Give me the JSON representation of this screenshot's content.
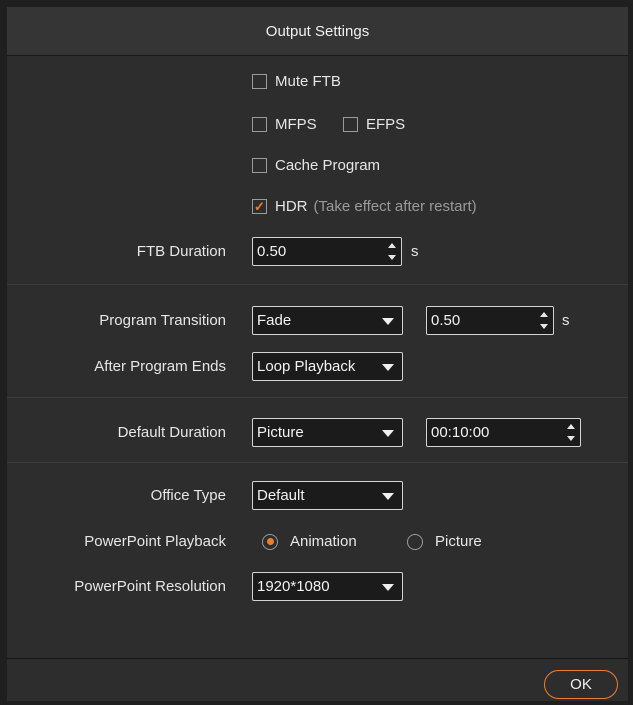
{
  "dialog": {
    "title": "Output Settings"
  },
  "checkboxes": {
    "mute_ftb": {
      "label": "Mute FTB",
      "checked": false
    },
    "mfps": {
      "label": "MFPS",
      "checked": false
    },
    "efps": {
      "label": "EFPS",
      "checked": false
    },
    "cache_program": {
      "label": "Cache Program",
      "checked": false
    },
    "hdr": {
      "label": "HDR",
      "note": "(Take effect after restart)",
      "checked": true
    }
  },
  "ftb_duration": {
    "label": "FTB Duration",
    "value": "0.50",
    "unit": "s"
  },
  "program_transition": {
    "label": "Program Transition",
    "type": "Fade",
    "value": "0.50",
    "unit": "s"
  },
  "after_program_ends": {
    "label": "After Program Ends",
    "value": "Loop Playback"
  },
  "default_duration": {
    "label": "Default Duration",
    "type": "Picture",
    "value": "00:10:00"
  },
  "office_type": {
    "label": "Office Type",
    "value": "Default"
  },
  "powerpoint_playback": {
    "label": "PowerPoint Playback",
    "options": [
      "Animation",
      "Picture"
    ],
    "selected": "Animation"
  },
  "powerpoint_resolution": {
    "label": "PowerPoint Resolution",
    "value": "1920*1080"
  },
  "footer": {
    "ok_label": "OK"
  },
  "colors": {
    "accent": "#ef7d2e",
    "background": "#2d2d2d",
    "field": "#1b1b1b"
  }
}
